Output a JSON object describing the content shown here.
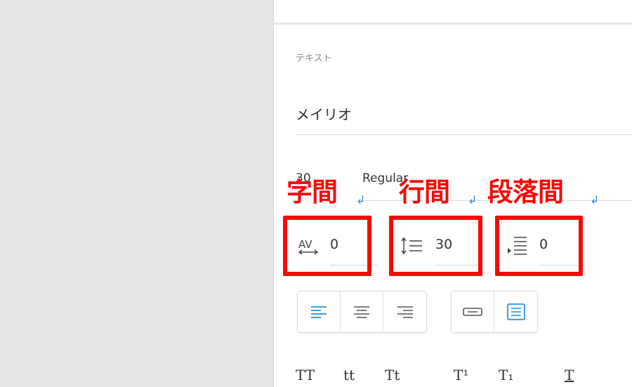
{
  "panel": {
    "section_label": "テキスト",
    "font_name": "メイリオ",
    "font_size": "30",
    "font_style": "Regular"
  },
  "fields": {
    "char_spacing": "0",
    "line_spacing": "30",
    "paragraph_spacing": "0"
  },
  "annotations": {
    "char_spacing": "字間",
    "line_spacing": "行間",
    "paragraph_spacing": "段落間",
    "return_mark": "↲"
  },
  "alignment": {
    "left": {
      "icon": "align-left-icon",
      "active": true
    },
    "center": {
      "icon": "align-center-icon",
      "active": false
    },
    "right": {
      "icon": "align-right-icon",
      "active": false
    }
  },
  "text_box_mode": {
    "fixed": {
      "icon": "fixed-width-icon",
      "active": false
    },
    "area": {
      "icon": "text-area-icon",
      "active": true
    }
  },
  "typography": {
    "all_caps": "TT",
    "lowercase": "tt",
    "title_case": "Tt",
    "superscript": "T¹",
    "subscript": "T₁",
    "underline": "T"
  },
  "colors": {
    "accent": "#2b8fd9",
    "highlight": "#f50a0a",
    "canvas_bg": "#e5e5e5"
  }
}
